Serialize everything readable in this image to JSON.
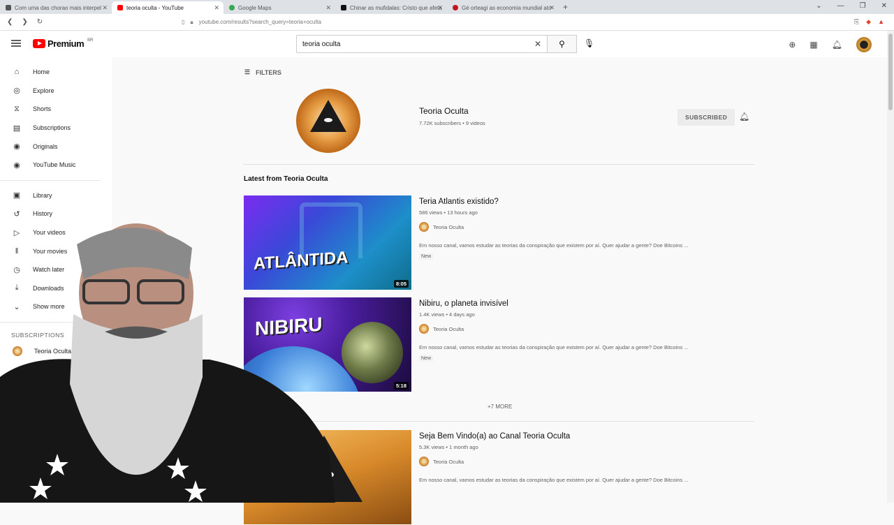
{
  "browser": {
    "tabs": [
      {
        "title": "Com uma das chorao mais interpel",
        "active": false,
        "color": "#555555"
      },
      {
        "title": "teoria oculta - YouTube",
        "active": true,
        "color": "#ff0000"
      },
      {
        "title": "Google Maps",
        "active": false,
        "color": "#34a853"
      },
      {
        "title": "Chinar as mufidalas: Cristo que afeta",
        "active": false,
        "color": "#111111"
      },
      {
        "title": "Gé orteagi as economia mundial ato",
        "active": false,
        "color": "#c4161c"
      }
    ],
    "url": "youtube.com/results?search_query=teoria+oculta"
  },
  "header": {
    "logo_text": "Premium",
    "logo_sup": "BR",
    "search_value": "teoria oculta"
  },
  "sidebar": {
    "main": [
      {
        "label": "Home",
        "icon": "home-icon",
        "glyph": "⌂"
      },
      {
        "label": "Explore",
        "icon": "compass-icon",
        "glyph": "◎"
      },
      {
        "label": "Shorts",
        "icon": "shorts-icon",
        "glyph": "⧖"
      },
      {
        "label": "Subscriptions",
        "icon": "subscriptions-icon",
        "glyph": "▤"
      },
      {
        "label": "Originals",
        "icon": "originals-icon",
        "glyph": "◉"
      },
      {
        "label": "YouTube Music",
        "icon": "music-icon",
        "glyph": "◉"
      }
    ],
    "library": [
      {
        "label": "Library",
        "icon": "library-icon",
        "glyph": "▣"
      },
      {
        "label": "History",
        "icon": "history-icon",
        "glyph": "↺"
      },
      {
        "label": "Your videos",
        "icon": "your-videos-icon",
        "glyph": "▷"
      },
      {
        "label": "Your movies",
        "icon": "movies-icon",
        "glyph": "‖"
      },
      {
        "label": "Watch later",
        "icon": "clock-icon",
        "glyph": "◷"
      },
      {
        "label": "Downloads",
        "icon": "download-icon",
        "glyph": "⤓"
      },
      {
        "label": "Show more",
        "icon": "chevron-down-icon",
        "glyph": "⌄"
      }
    ],
    "subscriptions_heading": "SUBSCRIPTIONS",
    "subscriptions": [
      {
        "label": "Teoria Oculta"
      }
    ]
  },
  "main": {
    "filters_label": "FILTERS",
    "channel": {
      "name": "Teoria Oculta",
      "meta": "7.72K subscribers • 9 videos",
      "subscribed_label": "SUBSCRIBED"
    },
    "latest_heading": "Latest from Teoria Oculta",
    "videos": [
      {
        "title": "Teria Atlantis existido?",
        "meta": "586 views • 13 hours ago",
        "channel": "Teoria Oculta",
        "description": "Em nosso canal, vamos estudar as teorias da conspiração que existem por aí. Quer ajudar a gente? Doe Bitcoins ...",
        "badge": "New",
        "duration": "8:05",
        "thumb_text": "ATLÂNTIDA"
      },
      {
        "title": "Nibiru, o planeta invisível",
        "meta": "1.4K views • 4 days ago",
        "channel": "Teoria Oculta",
        "description": "Em nosso canal, vamos estudar as teorias da conspiração que existem por aí. Quer ajudar a gente? Doe Bitcoins ...",
        "badge": "New",
        "duration": "5:18",
        "thumb_text": "NIBIRU"
      },
      {
        "title": "Seja Bem Vindo(a) ao Canal Teoria Oculta",
        "meta": "5.3K views • 1 month ago",
        "channel": "Teoria Oculta",
        "description": "Em nosso canal, vamos estudar as teorias da conspiração que existem por aí. Quer ajudar a gente? Doe Bitcoins ..."
      }
    ],
    "more_label": "+7 MORE"
  }
}
